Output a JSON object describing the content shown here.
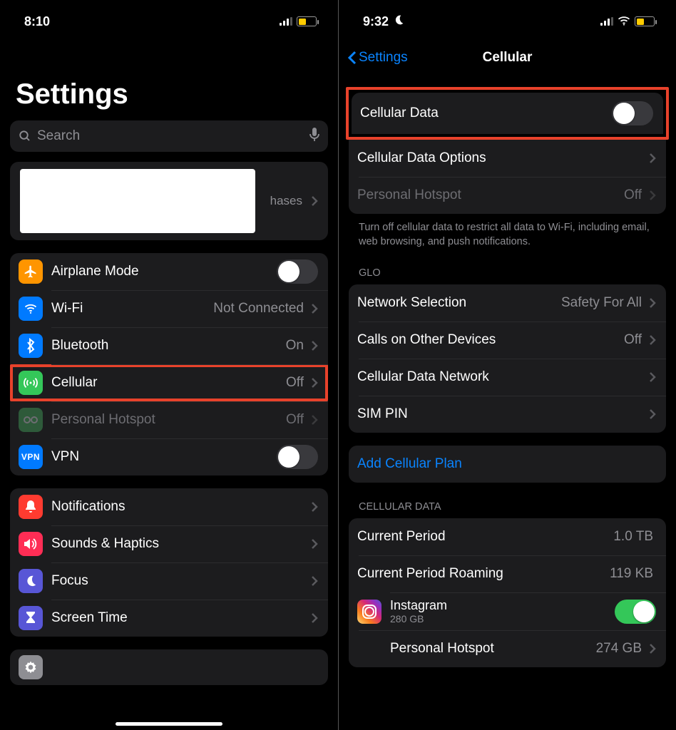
{
  "left": {
    "status": {
      "time": "8:10"
    },
    "title": "Settings",
    "search_placeholder": "Search",
    "account_suffix": "hases",
    "rows": {
      "airplane": "Airplane Mode",
      "wifi": "Wi-Fi",
      "wifi_val": "Not Connected",
      "bluetooth": "Bluetooth",
      "bluetooth_val": "On",
      "cellular": "Cellular",
      "cellular_val": "Off",
      "hotspot": "Personal Hotspot",
      "hotspot_val": "Off",
      "vpn": "VPN",
      "notifications": "Notifications",
      "sounds": "Sounds & Haptics",
      "focus": "Focus",
      "screentime": "Screen Time"
    }
  },
  "right": {
    "status": {
      "time": "9:32"
    },
    "back": "Settings",
    "title": "Cellular",
    "rows": {
      "cell_data": "Cellular Data",
      "cell_opts": "Cellular Data Options",
      "hotspot": "Personal Hotspot",
      "hotspot_val": "Off",
      "footer": "Turn off cellular data to restrict all data to Wi-Fi, including email, web browsing, and push notifications.",
      "section_glo": "GLO",
      "netsel": "Network Selection",
      "netsel_val": "Safety For All",
      "calls": "Calls on Other Devices",
      "calls_val": "Off",
      "cdn": "Cellular Data Network",
      "simpin": "SIM PIN",
      "add_plan": "Add Cellular Plan",
      "section_cd": "CELLULAR DATA",
      "cur_period": "Current Period",
      "cur_period_val": "1.0 TB",
      "cur_roam": "Current Period Roaming",
      "cur_roam_val": "119 KB",
      "instagram": "Instagram",
      "instagram_sub": "280 GB",
      "ph": "Personal Hotspot",
      "ph_val": "274 GB"
    }
  }
}
